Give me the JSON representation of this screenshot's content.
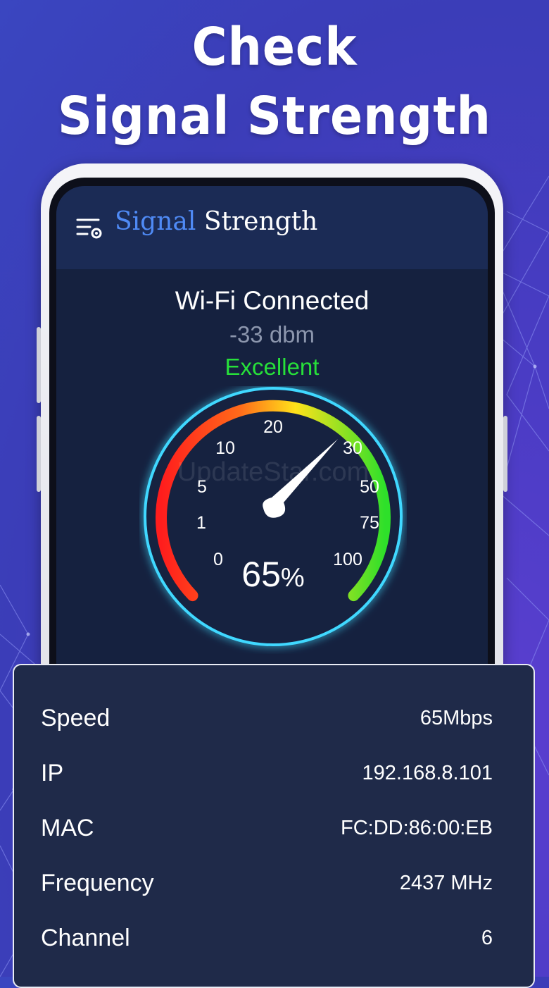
{
  "headline": {
    "line1": "Check",
    "line2": "Signal Strength"
  },
  "app": {
    "title_accent": "Signal",
    "title_rest": " Strength",
    "menu_icon": "menu-settings-icon"
  },
  "status": {
    "title": "Wi-Fi Connected",
    "dbm": "-33 dbm",
    "quality": "Excellent"
  },
  "gauge": {
    "percent_text": "65",
    "percent_sign": "%",
    "ticks": [
      "0",
      "1",
      "5",
      "10",
      "20",
      "30",
      "50",
      "75",
      "100"
    ],
    "needle_value": 30
  },
  "watermark": "UpdateStar.com",
  "details": [
    {
      "label": "Speed",
      "value": "65Mbps"
    },
    {
      "label": "IP",
      "value": "192.168.8.101"
    },
    {
      "label": "MAC",
      "value": "FC:DD:86:00:EB"
    },
    {
      "label": "Frequency",
      "value": "2437 MHz"
    },
    {
      "label": "Channel",
      "value": "6"
    }
  ],
  "colors": {
    "accent": "#4f8af5",
    "excellent": "#27e03a",
    "ring": "#3fd8ff"
  }
}
